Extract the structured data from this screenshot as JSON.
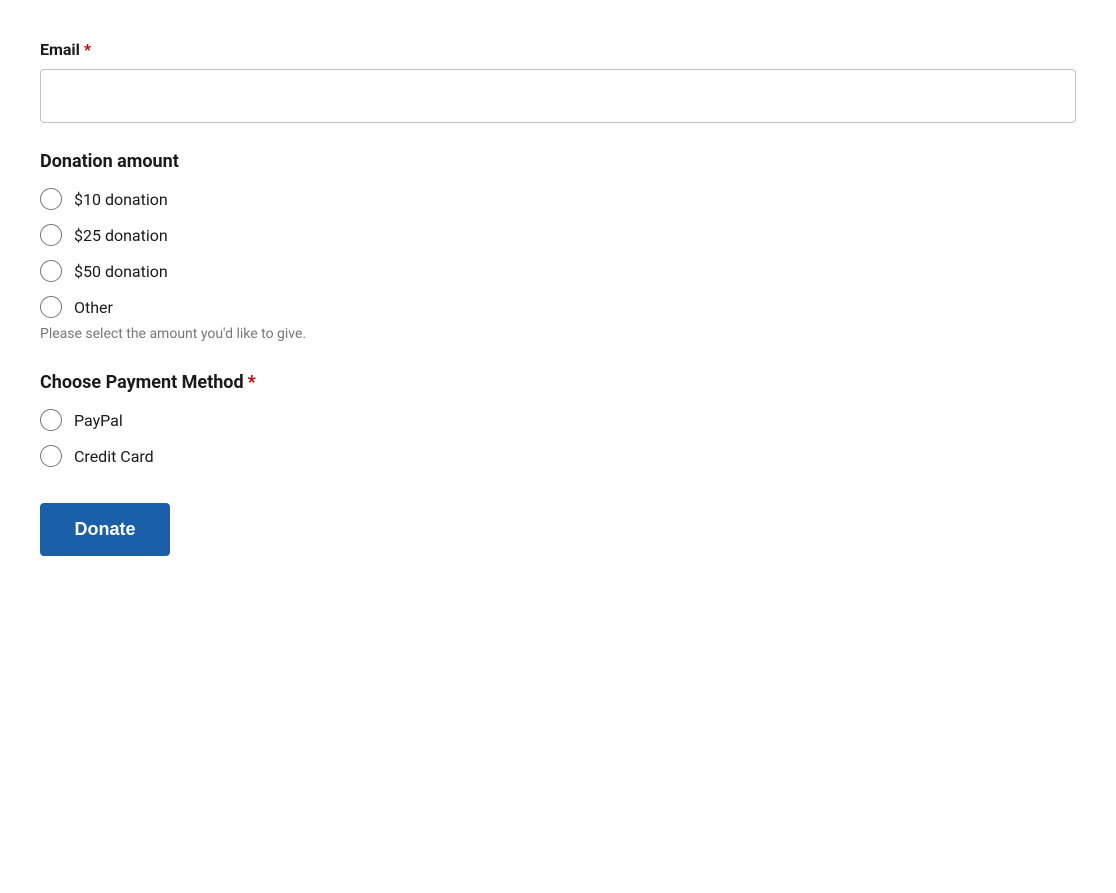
{
  "form": {
    "email_label": "Email",
    "email_required": "*",
    "email_placeholder": "",
    "donation_amount_title": "Donation amount",
    "donation_options": [
      {
        "id": "donation-10",
        "label": "$10 donation",
        "value": "10"
      },
      {
        "id": "donation-25",
        "label": "$25 donation",
        "value": "25"
      },
      {
        "id": "donation-50",
        "label": "$50 donation",
        "value": "50"
      },
      {
        "id": "donation-other",
        "label": "Other",
        "value": "other"
      }
    ],
    "donation_hint": "Please select the amount you'd like to give.",
    "payment_method_title": "Choose Payment Method",
    "payment_required": "*",
    "payment_options": [
      {
        "id": "paypal",
        "label": "PayPal",
        "value": "paypal"
      },
      {
        "id": "credit-card",
        "label": "Credit Card",
        "value": "credit_card"
      }
    ],
    "donate_button_label": "Donate"
  }
}
